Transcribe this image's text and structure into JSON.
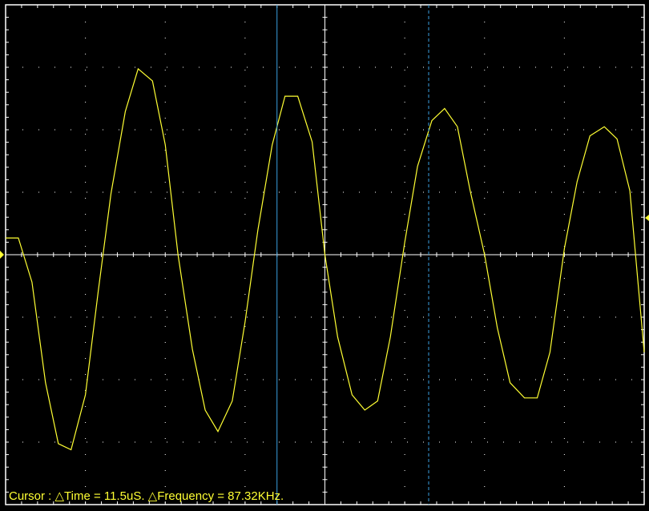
{
  "colors": {
    "background": "#000000",
    "grid": "#ffffff",
    "trace": "#ffff33",
    "cursor1": "#3aa0e0",
    "cursor2": "#3aa0e0",
    "readout_text": "#ffff33"
  },
  "cursor_readout": {
    "text": "Cursor : △Time = 11.5uS. △Frequency = 87.32KHz."
  },
  "chart_data": {
    "type": "line",
    "grid": true,
    "x_divisions": 8,
    "y_divisions": 8,
    "x_range": [
      0,
      8
    ],
    "y_range": [
      -4,
      4
    ],
    "cursors_div": [
      3.4,
      5.3
    ],
    "series": [
      {
        "x": [
          0,
          0.16,
          0.33,
          0.5,
          0.66,
          0.82,
          1.0,
          1.16,
          1.32,
          1.5,
          1.66,
          1.84,
          2.0,
          2.16,
          2.34,
          2.5,
          2.66,
          2.84,
          3.0,
          3.16,
          3.34,
          3.5,
          3.66,
          3.84,
          4.0,
          4.16,
          4.34,
          4.5,
          4.66,
          4.82,
          5.0,
          5.16,
          5.34,
          5.5,
          5.66,
          5.82,
          6.0,
          6.16,
          6.32,
          6.5,
          6.66,
          6.82,
          7.0,
          7.16,
          7.32,
          7.5,
          7.66,
          7.82,
          8.0
        ],
        "y": [
          0.55,
          0.55,
          -0.9,
          -4.2,
          -6.2,
          -6.4,
          -4.6,
          -1.2,
          2.0,
          4.7,
          6.1,
          5.7,
          3.6,
          0.0,
          -3.1,
          -5.1,
          -5.8,
          -4.8,
          -2.2,
          0.8,
          3.6,
          5.2,
          5.2,
          3.7,
          0.0,
          -2.7,
          -4.6,
          -5.1,
          -4.8,
          -2.7,
          0.4,
          2.9,
          4.4,
          4.8,
          4.2,
          2.1,
          0.0,
          -2.4,
          -4.2,
          -4.7,
          -4.7,
          -3.2,
          0.2,
          2.4,
          3.9,
          4.2,
          3.8,
          2.1,
          -3.2
        ]
      }
    ]
  }
}
